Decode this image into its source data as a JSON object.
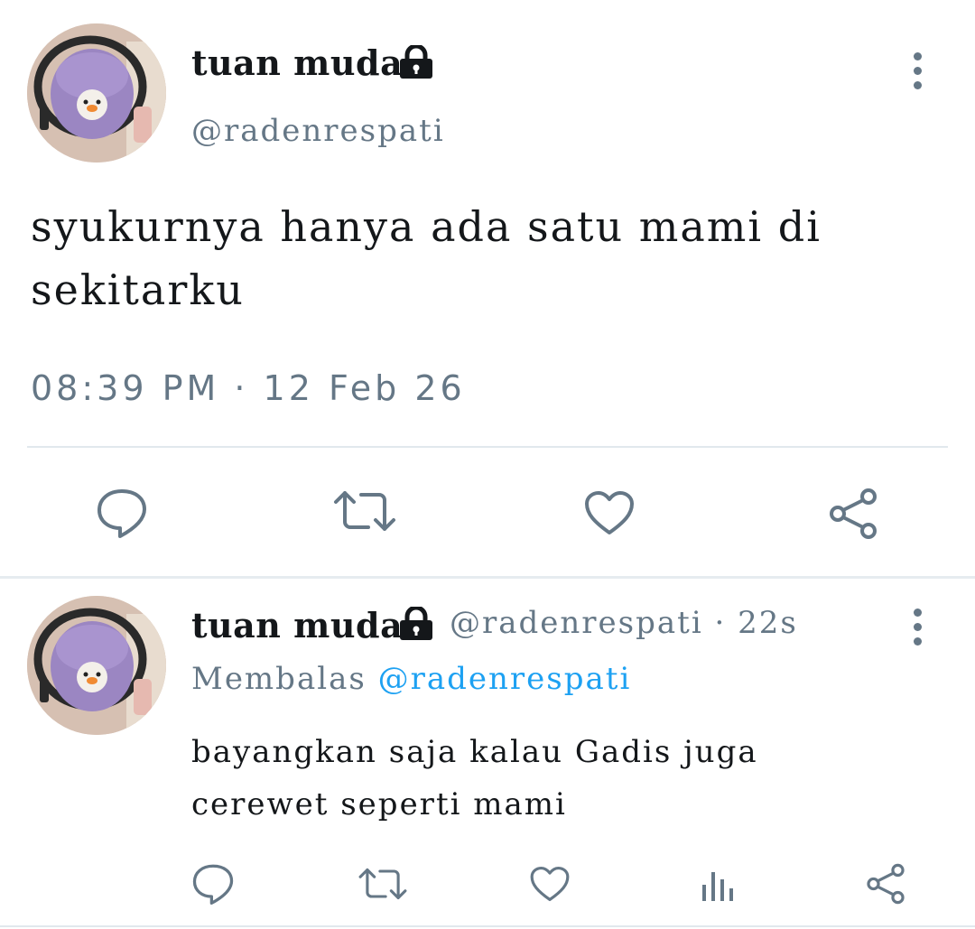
{
  "tweet": {
    "author_name": "tuan muda",
    "author_handle": "@radenrespati",
    "text": "syukurnya hanya ada satu mami di sekitarku",
    "timestamp": "08:39 PM · 12 Feb 26"
  },
  "reply": {
    "author_name": "tuan muda",
    "author_handle": "@radenrespati",
    "age": "· 22s",
    "replying_label": "Membalas",
    "replying_to": "@radenrespati",
    "text": "bayangkan saja kalau Gadis juga cerewet seperti mami"
  },
  "icons": {
    "lock": "lock-icon",
    "more": "more-vertical-icon",
    "reply": "reply-icon",
    "retweet": "retweet-icon",
    "like": "heart-icon",
    "share": "share-icon",
    "analytics": "analytics-icon"
  },
  "colors": {
    "text": "#14171a",
    "secondary": "#657786",
    "accent": "#1da1f2",
    "divider": "#e1e8ed"
  }
}
